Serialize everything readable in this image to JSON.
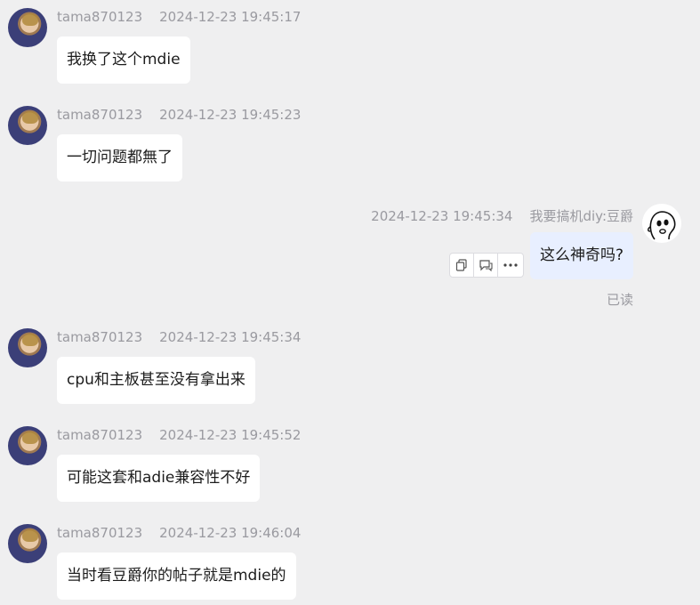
{
  "messages": [
    {
      "side": "left",
      "user": "tama870123",
      "time": "2024-12-23 19:45:17",
      "text": "我换了这个mdie"
    },
    {
      "side": "left",
      "user": "tama870123",
      "time": "2024-12-23 19:45:23",
      "text": "一切问题都無了"
    },
    {
      "side": "right",
      "user": "我要搞机diy:豆爵",
      "time": "2024-12-23 19:45:34",
      "text": "这么神奇吗?",
      "status": "已读"
    },
    {
      "side": "left",
      "user": "tama870123",
      "time": "2024-12-23 19:45:34",
      "text": "cpu和主板甚至没有拿出来"
    },
    {
      "side": "left",
      "user": "tama870123",
      "time": "2024-12-23 19:45:52",
      "text": "可能这套和adie兼容性不好"
    },
    {
      "side": "left",
      "user": "tama870123",
      "time": "2024-12-23 19:46:04",
      "text": "当时看豆爵你的帖子就是mdie的"
    }
  ],
  "actions": {
    "icons": [
      "copy-icon",
      "quote-reply-icon",
      "more-icon"
    ]
  }
}
